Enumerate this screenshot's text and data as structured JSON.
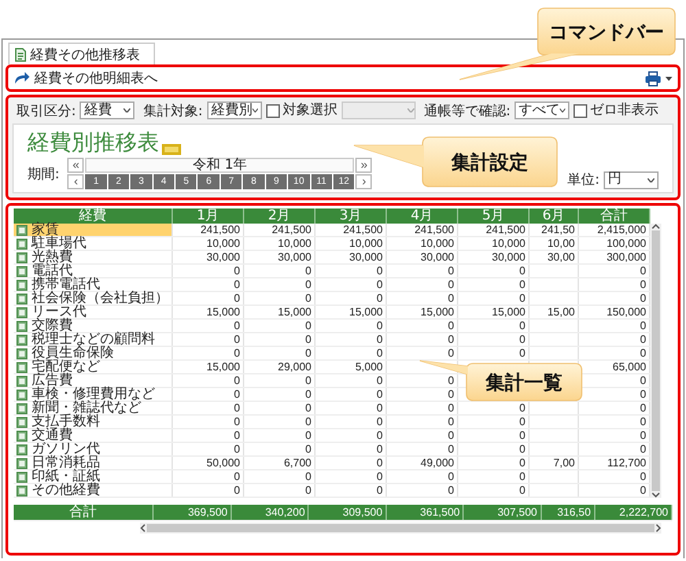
{
  "tab": {
    "label": "経費その他推移表"
  },
  "command_bar": {
    "link": "経費その他明細表へ"
  },
  "filters": [
    {
      "kind": "select",
      "label": "取引区分:",
      "value": "経費"
    },
    {
      "kind": "select",
      "label": "集計対象:",
      "value": "経費別"
    },
    {
      "kind": "checkbox",
      "label": "対象選択",
      "checked": false
    },
    {
      "kind": "combo",
      "disabled": true
    },
    {
      "kind": "select",
      "label": "通帳等で確認:",
      "value": "すべて"
    },
    {
      "kind": "checkbox",
      "label": "ゼロ非表示",
      "checked": false
    }
  ],
  "report": {
    "title": "経費別推移表",
    "period": {
      "label": "期間:",
      "year": "令和 1年",
      "first": "«",
      "prev": "‹",
      "next": "›",
      "last": "»",
      "months": [
        {
          "label": "1",
          "selected": true
        },
        {
          "label": "2",
          "selected": true
        },
        {
          "label": "3",
          "selected": true
        },
        {
          "label": "4",
          "selected": true
        },
        {
          "label": "5",
          "selected": true
        },
        {
          "label": "6",
          "selected": true
        },
        {
          "label": "7",
          "selected": true
        },
        {
          "label": "8",
          "selected": true
        },
        {
          "label": "9",
          "selected": true
        },
        {
          "label": "10",
          "selected": true
        },
        {
          "label": "11",
          "selected": true
        },
        {
          "label": "12",
          "selected": true
        }
      ]
    },
    "unit": {
      "label": "単位:",
      "value": "円"
    }
  },
  "table": {
    "columns": [
      "経費",
      "1月",
      "2月",
      "3月",
      "4月",
      "5月",
      "6月",
      "合計"
    ],
    "rows": [
      {
        "name": "家賃",
        "selected": true,
        "cells": {
          "m1": "241,500",
          "m2": "241,500",
          "m3": "241,500",
          "m4": "241,500",
          "m5": "241,500",
          "m6": "241,50",
          "total": "2,415,000"
        }
      },
      {
        "name": "駐車場代",
        "selected": false,
        "cells": {
          "m1": "10,000",
          "m2": "10,000",
          "m3": "10,000",
          "m4": "10,000",
          "m5": "10,000",
          "m6": "10,00",
          "total": "100,000"
        }
      },
      {
        "name": "光熱費",
        "selected": false,
        "cells": {
          "m1": "30,000",
          "m2": "30,000",
          "m3": "30,000",
          "m4": "30,000",
          "m5": "30,000",
          "m6": "30,00",
          "total": "300,000"
        }
      },
      {
        "name": "電話代",
        "selected": false,
        "cells": {
          "m1": "0",
          "m2": "0",
          "m3": "0",
          "m4": "0",
          "m5": "0",
          "total": "0"
        }
      },
      {
        "name": "携帯電話代",
        "selected": false,
        "cells": {
          "m1": "0",
          "m2": "0",
          "m3": "0",
          "m4": "0",
          "m5": "0",
          "total": "0"
        }
      },
      {
        "name": "社会保険（会社負担）",
        "selected": false,
        "cells": {
          "m1": "0",
          "m2": "0",
          "m3": "0",
          "m4": "0",
          "m5": "0",
          "total": "0"
        }
      },
      {
        "name": "リース代",
        "selected": false,
        "cells": {
          "m1": "15,000",
          "m2": "15,000",
          "m3": "15,000",
          "m4": "15,000",
          "m5": "15,000",
          "m6": "15,00",
          "total": "150,000"
        }
      },
      {
        "name": "交際費",
        "selected": false,
        "cells": {
          "m1": "0",
          "m2": "0",
          "m3": "0",
          "m4": "0",
          "m5": "0",
          "total": "0"
        }
      },
      {
        "name": "税理士などの顧問料",
        "selected": false,
        "cells": {
          "m1": "0",
          "m2": "0",
          "m3": "0",
          "m4": "0",
          "m5": "0",
          "total": "0"
        }
      },
      {
        "name": "役員生命保険",
        "selected": false,
        "cells": {
          "m1": "0",
          "m2": "0",
          "m3": "0",
          "m4": "0",
          "m5": "0",
          "total": "0"
        }
      },
      {
        "name": "宅配便など",
        "selected": false,
        "cells": {
          "m1": "15,000",
          "m2": "29,000",
          "m3": "5,000",
          "total": "65,000"
        }
      },
      {
        "name": "広告費",
        "selected": false,
        "cells": {
          "m1": "0",
          "m2": "0",
          "m3": "0",
          "m4": "0",
          "total": "0"
        }
      },
      {
        "name": "車検・修理費用など",
        "selected": false,
        "cells": {
          "m1": "0",
          "m2": "0",
          "m3": "0",
          "m4": "0",
          "total": "0"
        }
      },
      {
        "name": "新聞・雑誌代など",
        "selected": false,
        "cells": {
          "m1": "0",
          "m2": "0",
          "m3": "0",
          "m4": "0",
          "m5": "0",
          "total": "0"
        }
      },
      {
        "name": "支払手数料",
        "selected": false,
        "cells": {
          "m1": "0",
          "m2": "0",
          "m3": "0",
          "m4": "0",
          "m5": "0",
          "total": "0"
        }
      },
      {
        "name": "交通費",
        "selected": false,
        "cells": {
          "m1": "0",
          "m2": "0",
          "m3": "0",
          "m4": "0",
          "m5": "0",
          "total": "0"
        }
      },
      {
        "name": "ガソリン代",
        "selected": false,
        "cells": {
          "m1": "0",
          "m2": "0",
          "m3": "0",
          "m4": "0",
          "m5": "0",
          "total": "0"
        }
      },
      {
        "name": "日常消耗品",
        "selected": false,
        "cells": {
          "m1": "50,000",
          "m2": "6,700",
          "m3": "0",
          "m4": "49,000",
          "m5": "0",
          "m6": "7,00",
          "total": "112,700"
        }
      },
      {
        "name": "印紙・証紙",
        "selected": false,
        "cells": {
          "m1": "0",
          "m2": "0",
          "m3": "0",
          "m4": "0",
          "m5": "0",
          "total": "0"
        }
      },
      {
        "name": "その他経費",
        "selected": false,
        "cells": {
          "m1": "0",
          "m2": "0",
          "m3": "0",
          "m4": "0",
          "m5": "0",
          "total": "0"
        }
      }
    ],
    "footer": {
      "label": "合計",
      "cells": {
        "m1": "369,500",
        "m2": "340,200",
        "m3": "309,500",
        "m4": "361,500",
        "m5": "307,500",
        "m6": "316,50",
        "total": "2,222,700"
      }
    }
  },
  "annotations": [
    {
      "text": "コマンドバー"
    },
    {
      "text": "集計設定"
    },
    {
      "text": "集計一覧"
    }
  ]
}
